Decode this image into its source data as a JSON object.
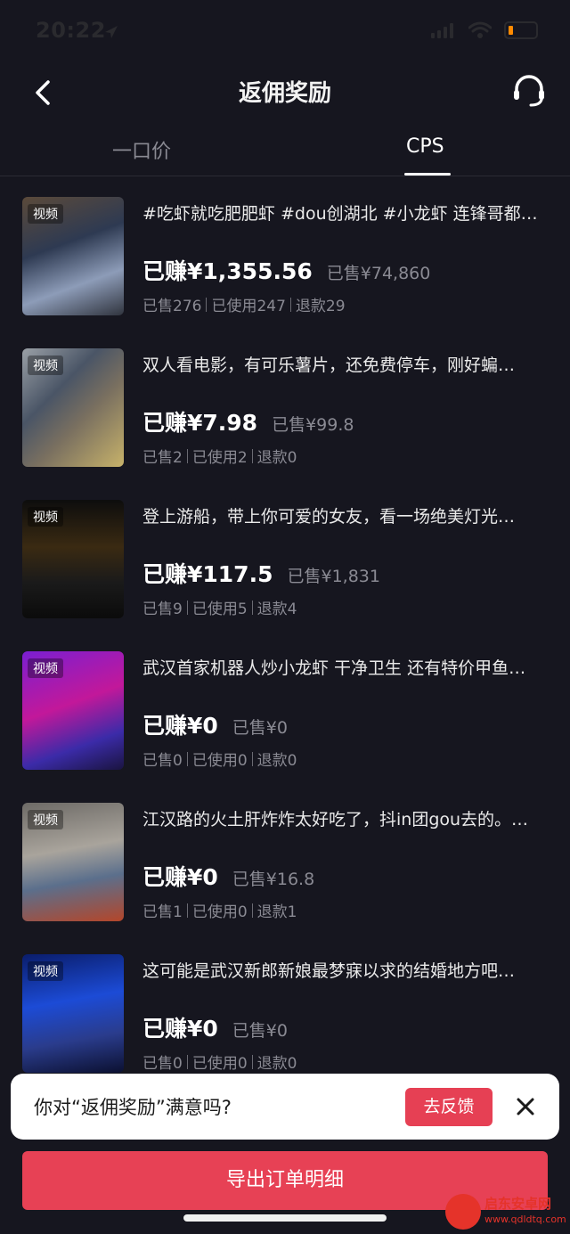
{
  "status_bar": {
    "time": "20:22"
  },
  "nav": {
    "title": "返佣奖励"
  },
  "tabs": [
    {
      "label": "一口价",
      "active": false
    },
    {
      "label": "CPS",
      "active": true
    }
  ],
  "items": [
    {
      "title": "#吃虾就吃肥肥虾 #dou创湖北 #小龙虾 连锋哥都…",
      "tag": "视频",
      "earned": "已赚¥1,355.56",
      "sold_amount": "已售¥74,860",
      "sold": "已售276",
      "used": "已使用247",
      "refund": "退款29"
    },
    {
      "title": "双人看电影，有可乐薯片，还免费停车，刚好蝙…",
      "tag": "视频",
      "earned": "已赚¥7.98",
      "sold_amount": "已售¥99.8",
      "sold": "已售2",
      "used": "已使用2",
      "refund": "退款0"
    },
    {
      "title": "登上游船，带上你可爱的女友，看一场绝美灯光…",
      "tag": "视频",
      "earned": "已赚¥117.5",
      "sold_amount": "已售¥1,831",
      "sold": "已售9",
      "used": "已使用5",
      "refund": "退款4"
    },
    {
      "title": "武汉首家机器人炒小龙虾 干净卫生 还有特价甲鱼…",
      "tag": "视频",
      "earned": "已赚¥0",
      "sold_amount": "已售¥0",
      "sold": "已售0",
      "used": "已使用0",
      "refund": "退款0"
    },
    {
      "title": "江汉路的火土肝炸炸太好吃了，抖in团gou去的。…",
      "tag": "视频",
      "earned": "已赚¥0",
      "sold_amount": "已售¥16.8",
      "sold": "已售1",
      "used": "已使用0",
      "refund": "退款1"
    },
    {
      "title": "这可能是武汉新郎新娘最梦寐以求的结婚地方吧…",
      "tag": "视频",
      "earned": "已赚¥0",
      "sold_amount": "已售¥0",
      "sold": "已售0",
      "used": "已使用0",
      "refund": "退款0"
    }
  ],
  "feedback": {
    "question": "你对“返佣奖励”满意吗?",
    "button_label": "去反馈"
  },
  "export": {
    "label": "导出订单明细"
  },
  "watermark": {
    "name": "启东安卓网",
    "url": "www.qdldtq.com"
  },
  "colors": {
    "accent": "#e74155",
    "background": "#16161f"
  }
}
